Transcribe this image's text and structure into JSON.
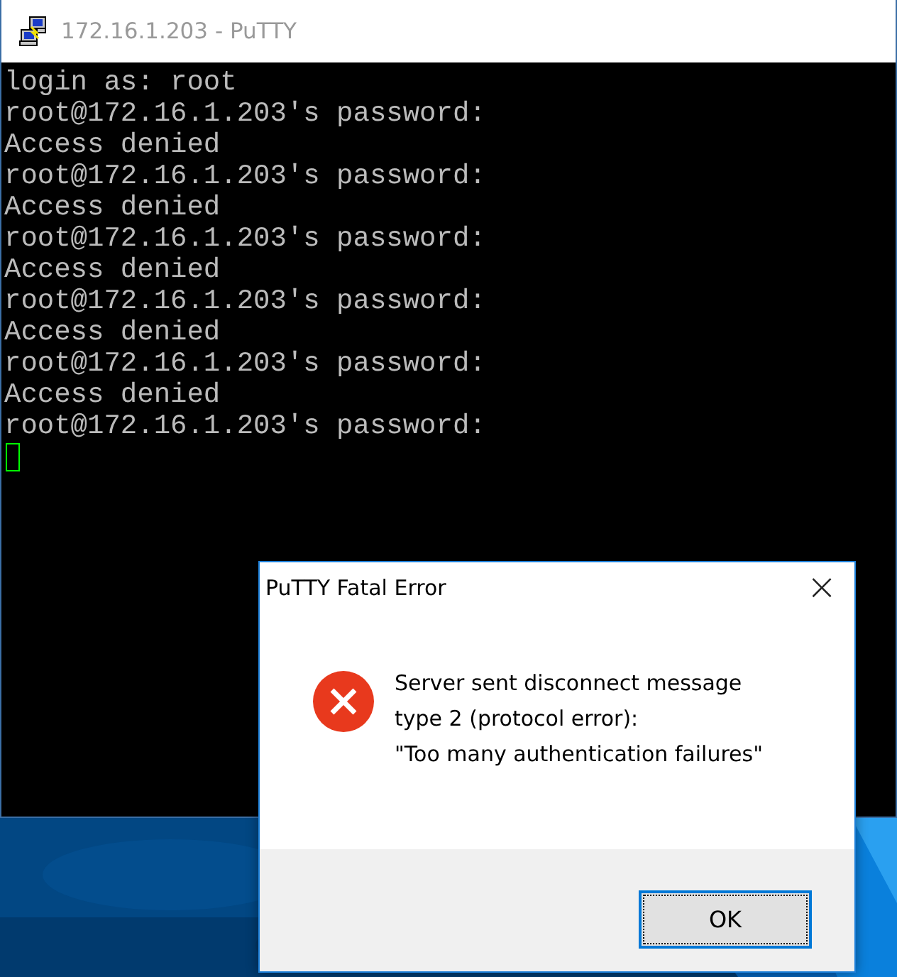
{
  "window": {
    "title": "172.16.1.203 - PuTTY"
  },
  "terminal": {
    "lines": [
      "login as: root",
      "root@172.16.1.203's password:",
      "Access denied",
      "root@172.16.1.203's password:",
      "Access denied",
      "root@172.16.1.203's password:",
      "Access denied",
      "root@172.16.1.203's password:",
      "Access denied",
      "root@172.16.1.203's password:",
      "Access denied",
      "root@172.16.1.203's password:"
    ],
    "cursor": true
  },
  "dialog": {
    "title": "PuTTY Fatal Error",
    "close": "×",
    "message_lines": [
      "Server sent disconnect message",
      "type 2 (protocol error):",
      "\"Too many authentication failures\""
    ],
    "buttons": [
      "OK"
    ]
  }
}
